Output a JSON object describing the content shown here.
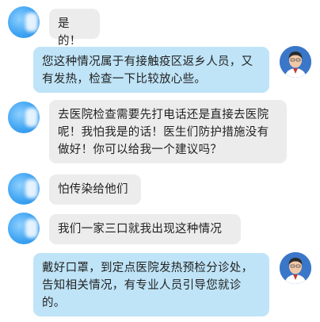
{
  "messages": [
    {
      "sender": "patient",
      "text": "是的！"
    },
    {
      "sender": "doctor",
      "text": "您这种情况属于有接触疫区返乡人员，又有发热，检查一下比较放心些。"
    },
    {
      "sender": "patient",
      "text": "去医院检查需要先打电话还是直接去医院呢！我怕我是的话！医生们防护措施没有做好！你可以给我一个建议吗？"
    },
    {
      "sender": "patient",
      "text": "怕传染给他们"
    },
    {
      "sender": "patient",
      "text": "我们一家三口就我出现这种情况"
    },
    {
      "sender": "doctor",
      "text": "戴好口罩，到定点医院发热预检分诊处，告知相关情况，有专业人员引导您就诊的。"
    }
  ]
}
